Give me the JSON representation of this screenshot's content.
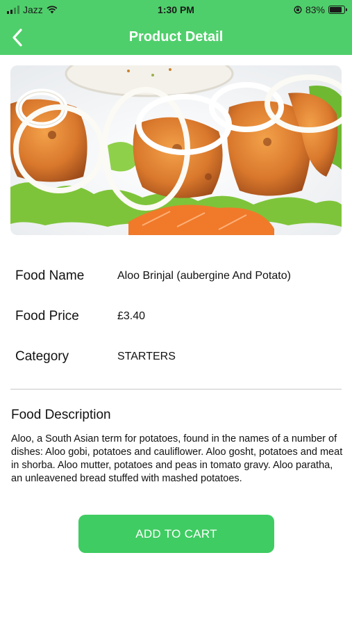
{
  "status_bar": {
    "carrier": "Jazz",
    "time": "1:30 PM",
    "battery_percent": "83%",
    "battery_level": 0.83,
    "icons": [
      "signal-icon",
      "wifi-icon",
      "screen-lock-icon",
      "battery-icon"
    ]
  },
  "nav": {
    "title": "Product Detail",
    "back_icon": "chevron-left-icon"
  },
  "product": {
    "image_icon": "food-photo",
    "fields": [
      {
        "label": "Food Name",
        "value": "Aloo Brinjal (aubergine And Potato)"
      },
      {
        "label": "Food Price",
        "value": "£3.40"
      },
      {
        "label": "Category",
        "value": "STARTERS"
      }
    ],
    "description_title": "Food Description",
    "description": "Aloo, a South Asian term for potatoes, found in the names of a number of dishes: Aloo gobi, potatoes and cauliflower. Aloo gosht, potatoes and meat in shorba. Aloo mutter, potatoes and peas in tomato gravy. Aloo paratha, an unleavened bread stuffed with mashed potatoes."
  },
  "actions": {
    "add_to_cart": "ADD TO CART"
  },
  "colors": {
    "primary_green": "#4fcf6b",
    "button_green": "#3fcc62"
  }
}
